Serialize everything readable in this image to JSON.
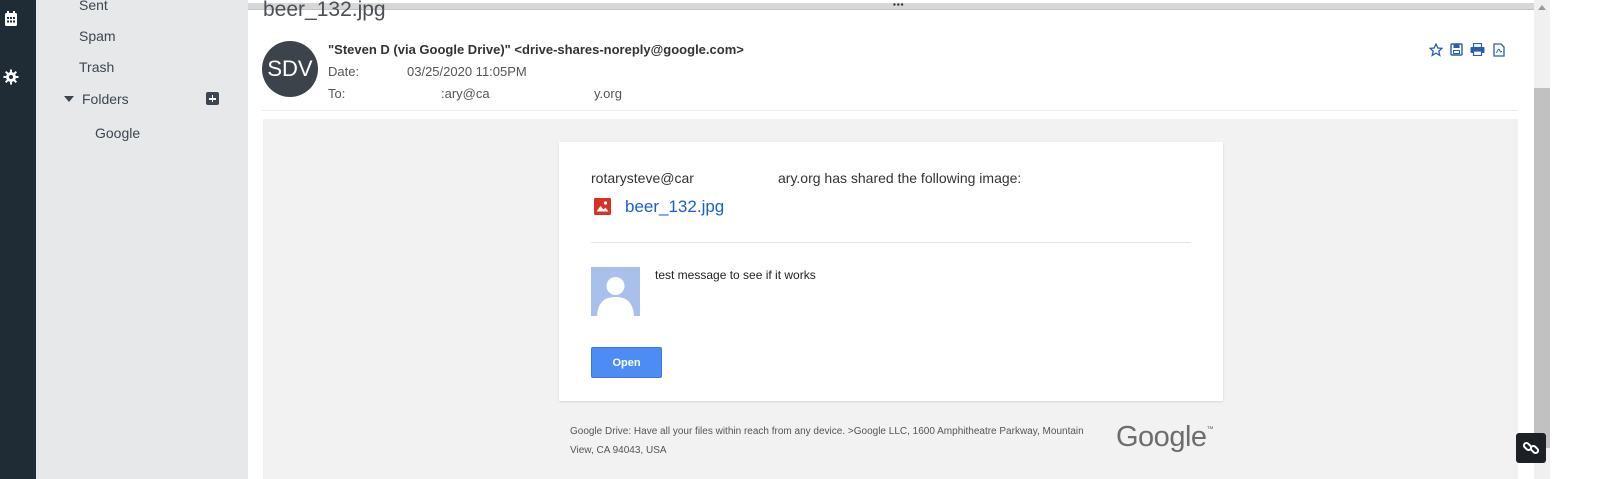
{
  "sidebar": {
    "items": [
      {
        "label": "Sent"
      },
      {
        "label": "Spam"
      },
      {
        "label": "Trash"
      }
    ],
    "folders_label": "Folders",
    "folder_children": [
      {
        "label": "Google"
      }
    ]
  },
  "message": {
    "subject": "beer_132.jpg",
    "avatar_initials": "SDV",
    "from": "\"Steven D (via Google Drive)\" <drive-shares-noreply@google.com>",
    "date_label": "Date:",
    "date_value": "03/25/2020 11:05PM",
    "to_label": "To:",
    "to_value_part1": ":ary@ca",
    "to_value_part2": "y.org"
  },
  "body": {
    "share_text_part1": "rotarysteve@car",
    "share_text_part2": "ary.org has shared the following image:",
    "file_name": "beer_132.jpg",
    "note": "test message to see if it works",
    "open_label": "Open",
    "footer": "Google Drive: Have all your files within reach from any device. >Google LLC, 1600 Amphitheatre Parkway, Mountain View, CA 94043, USA",
    "google_logo": "Google",
    "google_tm": "™"
  },
  "colors": {
    "rail": "#1f2b35",
    "sidebar": "#e7e8ea",
    "avatar": "#3d434a",
    "link": "#1a5fd1",
    "open_button": "#4d8cf5",
    "body_bg": "#f2f2f2"
  },
  "icons": {
    "rail": [
      "calendar-icon",
      "gear-icon"
    ],
    "actions": [
      "star-icon",
      "save-icon",
      "print-icon",
      "pdf-icon"
    ],
    "file": "image-file-icon",
    "widget": "link-icon"
  }
}
